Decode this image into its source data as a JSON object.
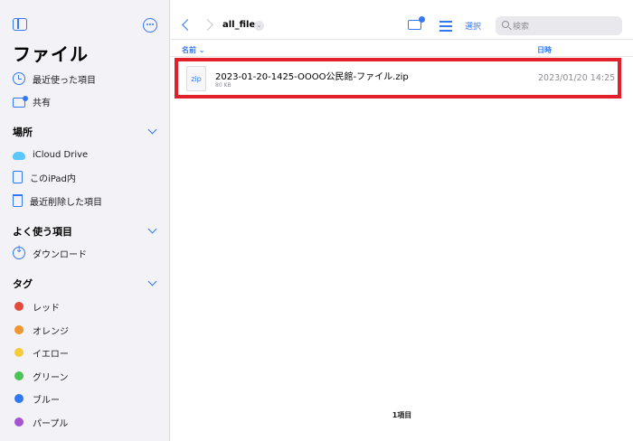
{
  "sidebar": {
    "title": "ファイル",
    "top_items": [
      {
        "label": "最近使った項目",
        "icon": "clock-icon"
      },
      {
        "label": "共有",
        "icon": "shared-folder-icon"
      }
    ],
    "sections": {
      "locations": {
        "title": "場所",
        "items": [
          {
            "label": "iCloud Drive",
            "icon": "icloud-icon"
          },
          {
            "label": "このiPad内",
            "icon": "ipad-icon"
          },
          {
            "label": "最近削除した項目",
            "icon": "trash-icon"
          }
        ]
      },
      "favorites": {
        "title": "よく使う項目",
        "items": [
          {
            "label": "ダウンロード",
            "icon": "download-icon"
          }
        ]
      },
      "tags": {
        "title": "タグ",
        "items": [
          {
            "label": "レッド",
            "color": "#e5483c"
          },
          {
            "label": "オレンジ",
            "color": "#f0952f"
          },
          {
            "label": "イエロー",
            "color": "#f5cc3c"
          },
          {
            "label": "グリーン",
            "color": "#4fc257"
          },
          {
            "label": "ブルー",
            "color": "#3178f0"
          },
          {
            "label": "パープル",
            "color": "#a653d3"
          }
        ]
      }
    }
  },
  "toolbar": {
    "folder_title": "all_file",
    "select_label": "選択",
    "search_placeholder": "検索"
  },
  "columns": {
    "name": "名前 ⌄",
    "date": "日時"
  },
  "files": [
    {
      "name": "2023-01-20-1425-OOOO公民館-ファイル.zip",
      "type_label": "zip",
      "size": "80 KB",
      "date": "2023/01/20 14:25",
      "highlighted": true
    }
  ],
  "footer": {
    "count": "1項目"
  },
  "colors": {
    "accent": "#3478f6",
    "highlight_border": "#e1202c"
  }
}
